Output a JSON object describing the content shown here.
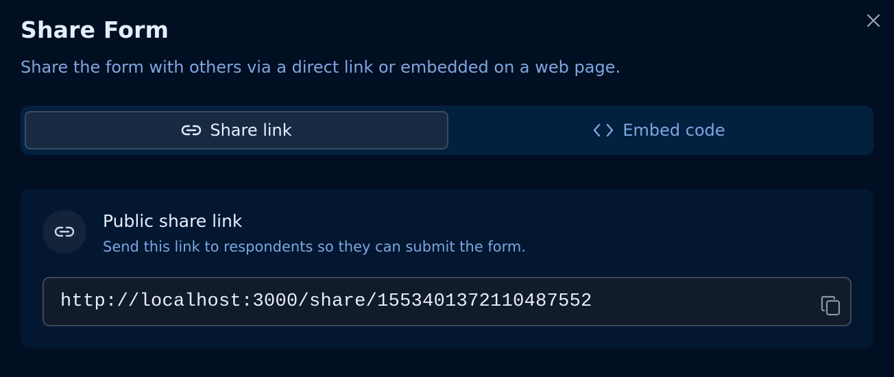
{
  "dialog": {
    "title": "Share Form",
    "subtitle": "Share the form with others via a direct link or embedded on a web page."
  },
  "tabs": [
    {
      "label": "Share link",
      "icon": "link-icon",
      "active": true
    },
    {
      "label": "Embed code",
      "icon": "code-icon",
      "active": false
    }
  ],
  "share_card": {
    "icon": "link-icon",
    "title": "Public share link",
    "description": "Send this link to respondents so they can submit the form.",
    "url": "http://localhost:3000/share/1553401372110487552",
    "copy_icon": "copy-icon"
  },
  "colors": {
    "background": "#020f22",
    "accent_text": "#7ea6e0",
    "primary_text": "#e6eefc",
    "tab_bar": "#04203f"
  }
}
